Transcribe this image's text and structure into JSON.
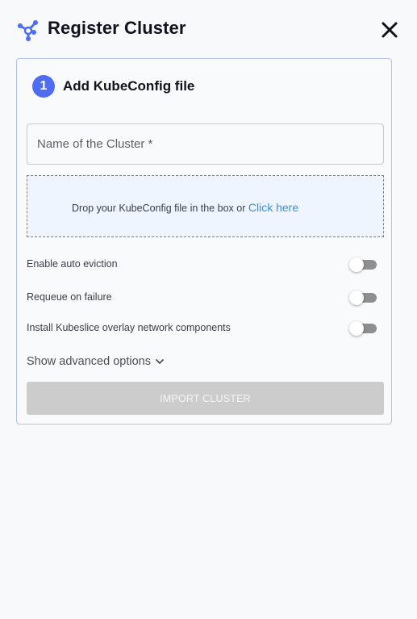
{
  "header": {
    "title": "Register Cluster",
    "logo_icon": "cluster-network-icon",
    "close_icon": "close-icon"
  },
  "step": {
    "number": "1",
    "title": "Add KubeConfig file"
  },
  "form": {
    "name_placeholder": "Name of the Cluster *",
    "name_value": "",
    "dropzone_text": "Drop your KubeConfig file in the box or",
    "dropzone_link": "Click here",
    "options": [
      {
        "label": "Enable auto eviction",
        "enabled": false
      },
      {
        "label": "Requeue on failure",
        "enabled": false
      },
      {
        "label": "Install Kubeslice overlay network components",
        "enabled": false
      }
    ],
    "advanced_label": "Show advanced options",
    "import_label": "IMPORT CLUSTER",
    "import_disabled": true
  },
  "colors": {
    "accent": "#4f6df2",
    "link": "#3c8fd8",
    "dropzone_border": "#2ea5a4",
    "dropzone_bg": "#eef5fe",
    "card_border": "#b7c1ee",
    "button_disabled": "#cccccc"
  }
}
